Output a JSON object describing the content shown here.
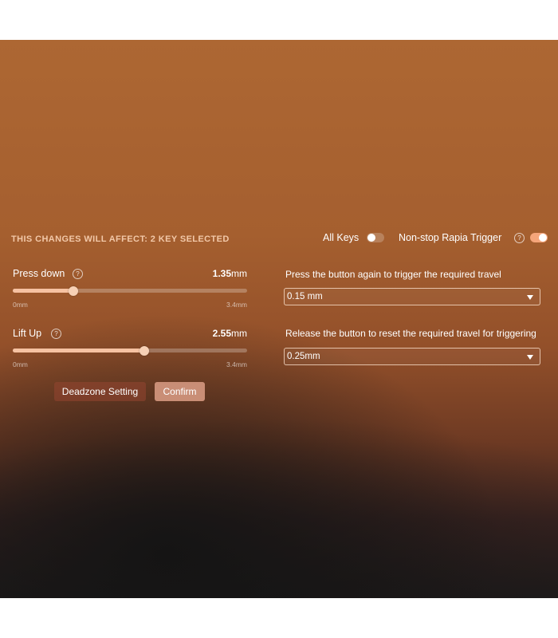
{
  "header": {
    "affect_text": "THIS CHANGES WILL AFFECT: 2 KEY SELECTED"
  },
  "toggles": {
    "all_keys": {
      "label": "All Keys",
      "on": false
    },
    "nonstop": {
      "label": "Non-stop Rapia Trigger",
      "help": "?",
      "on": true
    }
  },
  "press_down": {
    "label": "Press down",
    "help": "?",
    "value": "1.35",
    "unit": "mm",
    "min_label": "0mm",
    "max_label": "3.4mm",
    "fraction": 0.26
  },
  "lift_up": {
    "label": "Lift Up",
    "help": "?",
    "value": "2.55",
    "unit": "mm",
    "min_label": "0mm",
    "max_label": "3.4mm",
    "fraction": 0.56
  },
  "trigger": {
    "description": "Press the button again to trigger the required travel",
    "selected": "0.15 mm"
  },
  "reset": {
    "description": "Release the button to reset the required travel for triggering",
    "selected": "0.25mm"
  },
  "buttons": {
    "deadzone": "Deadzone Setting",
    "confirm": "Confirm"
  },
  "colors": {
    "accent": "#f5a57a",
    "slider_fill": "#f6c2a2",
    "confirm_bg": "#c98e76"
  }
}
